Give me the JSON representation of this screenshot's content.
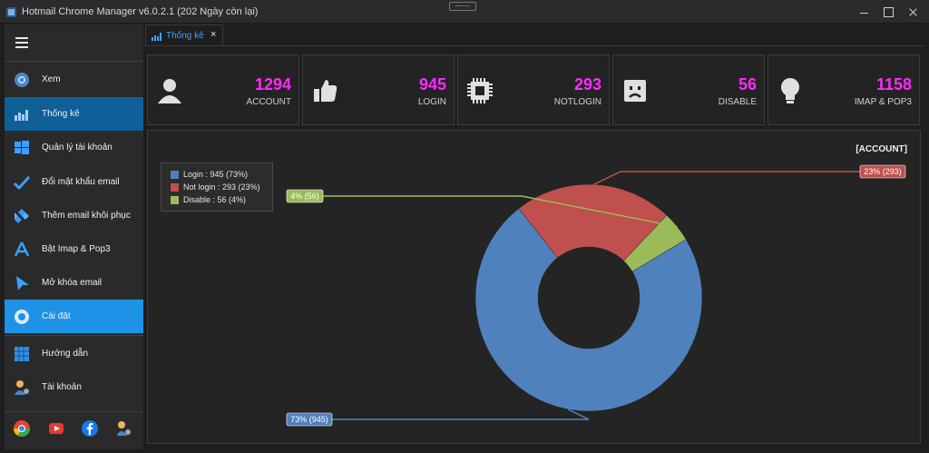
{
  "window": {
    "title": "Hotmail Chrome Manager v6.0.2.1 (202 Ngày còn lại)"
  },
  "sidebar": {
    "items": [
      {
        "label": "Xem",
        "icon": "chrome-icon"
      },
      {
        "label": "Thống kê",
        "icon": "bar-chart-icon"
      },
      {
        "label": "Quản lý tài khoản",
        "icon": "windows-icon"
      },
      {
        "label": "Đổi mật khẩu email",
        "icon": "check-icon"
      },
      {
        "label": "Thêm email khôi phục",
        "icon": "kodi-icon"
      },
      {
        "label": "Bật Imap & Pop3",
        "icon": "app-store-icon"
      },
      {
        "label": "Mở khóa email",
        "icon": "unlock-icon"
      },
      {
        "label": "Cài đặt",
        "icon": "settings-icon"
      },
      {
        "label": "Hướng dẫn",
        "icon": "grid-icon"
      },
      {
        "label": "Tài khoản",
        "icon": "user-gear-icon"
      }
    ],
    "active_index": 1,
    "hover_index": 7,
    "footer_icons": [
      "chrome-icon",
      "youtube-icon",
      "facebook-icon",
      "user-gear-icon"
    ]
  },
  "tabs": [
    {
      "label": "Thống kê",
      "close": "×"
    }
  ],
  "stats": [
    {
      "value": "1294",
      "label": "ACCOUNT",
      "icon": "user-icon"
    },
    {
      "value": "945",
      "label": "LOGIN",
      "icon": "thumbs-up-icon"
    },
    {
      "value": "293",
      "label": "NOTLOGIN",
      "icon": "chip-icon"
    },
    {
      "value": "56",
      "label": "DISABLE",
      "icon": "sad-face-icon"
    },
    {
      "value": "1158",
      "label": "IMAP & POP3",
      "icon": "lightbulb-icon"
    }
  ],
  "colors": {
    "accent_value": "#ff2bff",
    "active_nav": "#0f5f99",
    "hover_nav": "#1e92e6",
    "login": "#4f81bd",
    "not_login": "#c0504d",
    "disable": "#9bbb59"
  },
  "chart_data": {
    "type": "pie",
    "variant": "donut",
    "title": "[ACCOUNT]",
    "legend_position": "top-left",
    "series": [
      {
        "name": "Login",
        "value": 945,
        "legend_label": "Login : 945 (73%)",
        "data_label": "73% (945)",
        "color": "#4f81bd"
      },
      {
        "name": "Not login",
        "value": 293,
        "legend_label": "Not login : 293 (23%)",
        "data_label": "23% (293)",
        "color": "#c0504d"
      },
      {
        "name": "Disable",
        "value": 56,
        "legend_label": "Disable : 56 (4%)",
        "data_label": "4% (56)",
        "color": "#9bbb59"
      }
    ]
  }
}
